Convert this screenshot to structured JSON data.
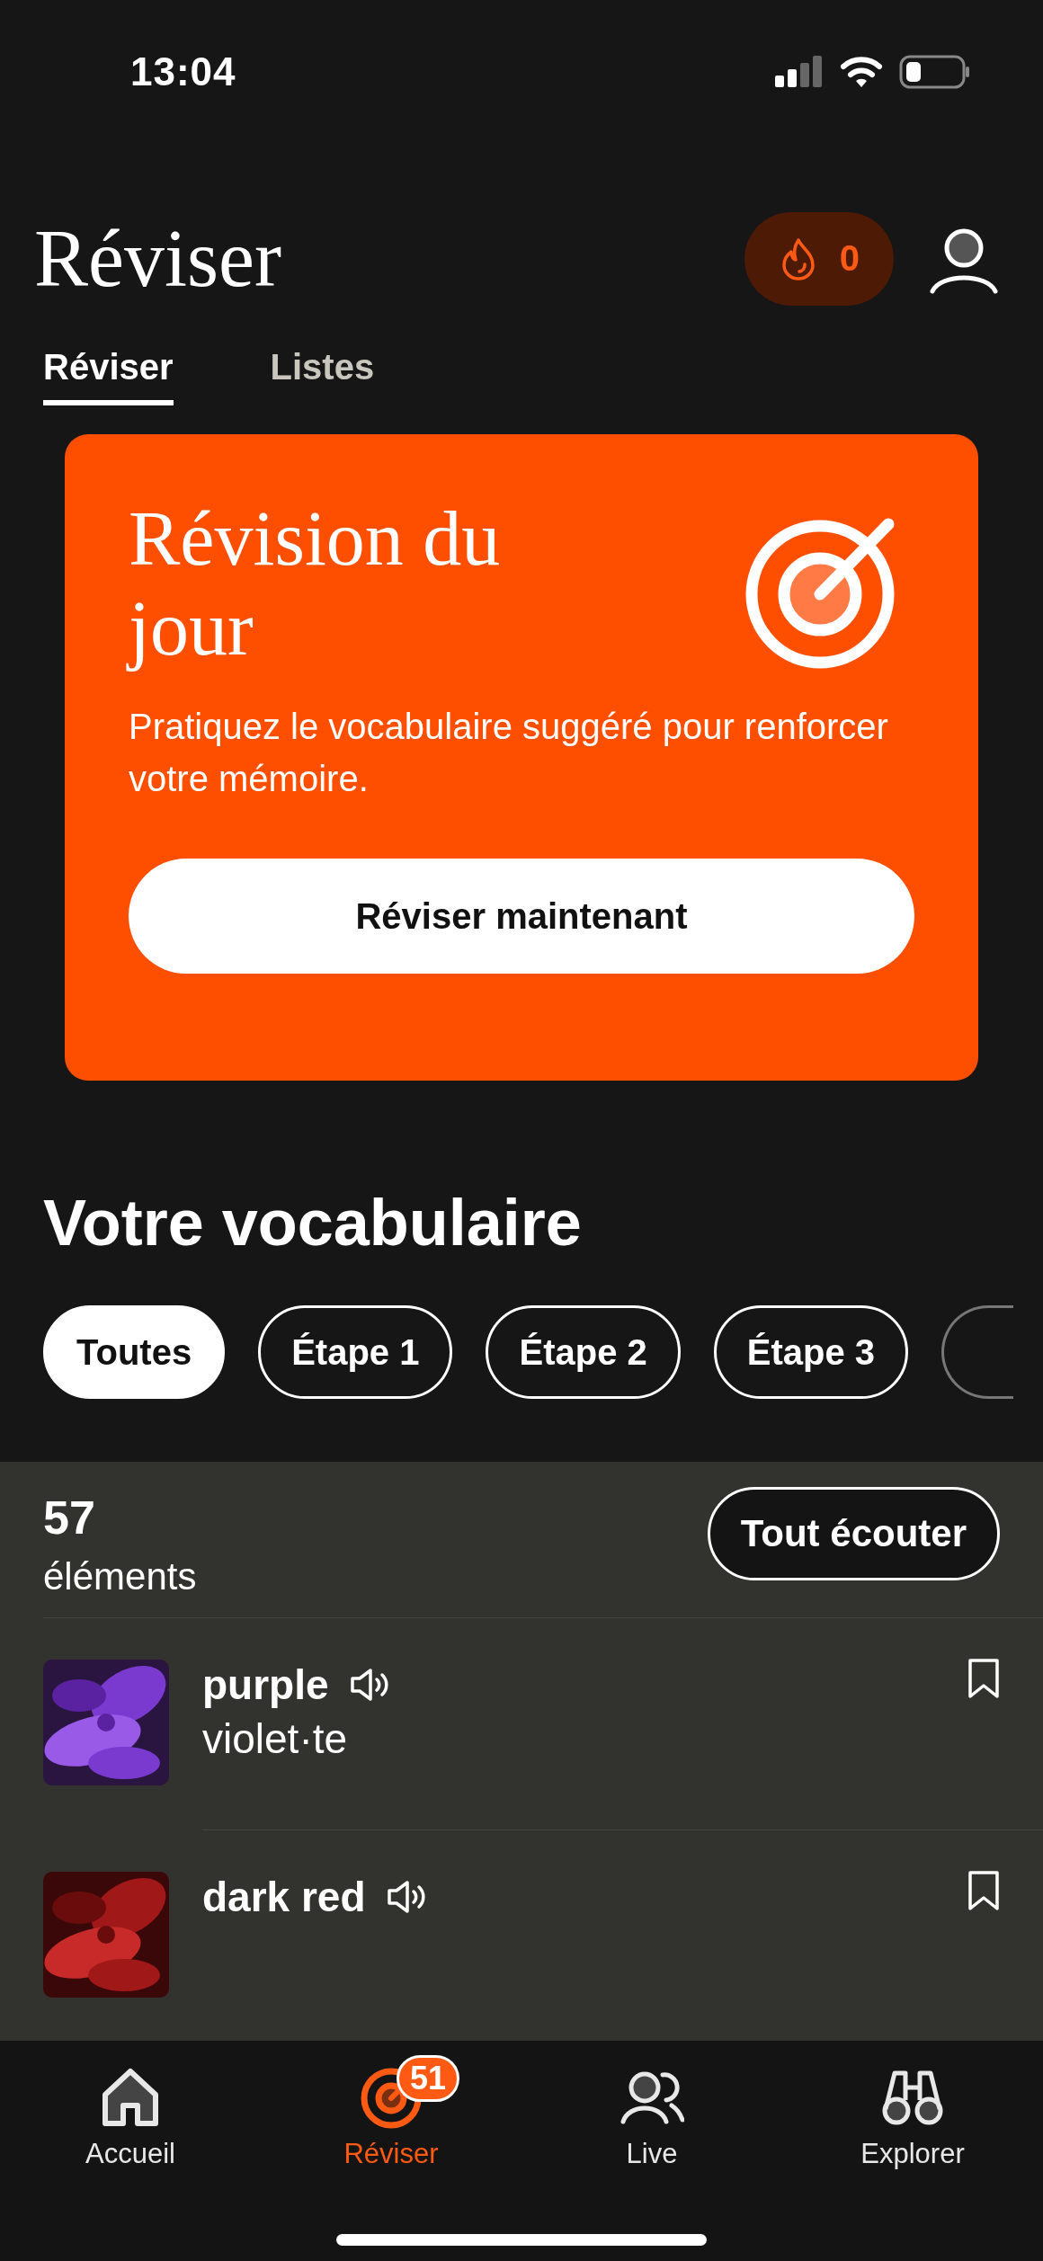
{
  "status_bar": {
    "time": "13:04"
  },
  "header": {
    "title": "Réviser",
    "streak": "0"
  },
  "tabs": [
    {
      "label": "Réviser",
      "selected": true
    },
    {
      "label": "Listes",
      "selected": false
    }
  ],
  "daily_card": {
    "title": "Révision du jour",
    "description": "Pratiquez le vocabulaire suggéré pour renforcer votre mémoire.",
    "button": "Réviser maintenant"
  },
  "vocabulary": {
    "heading": "Votre vocabulaire",
    "filters": [
      {
        "label": "Toutes",
        "selected": true
      },
      {
        "label": "Étape 1",
        "selected": false
      },
      {
        "label": "Étape 2",
        "selected": false
      },
      {
        "label": "Étape 3",
        "selected": false
      }
    ],
    "count": "57",
    "count_label": "éléments",
    "play_all": "Tout écouter",
    "items": [
      {
        "word": "purple",
        "translation": "violet·te",
        "bookmarked": false
      },
      {
        "word": "dark red",
        "bookmarked": false
      }
    ]
  },
  "nav": [
    {
      "label": "Accueil",
      "selected": false
    },
    {
      "label": "Réviser",
      "selected": true,
      "badge": "51"
    },
    {
      "label": "Live",
      "selected": false
    },
    {
      "label": "Explorer",
      "selected": false
    }
  ]
}
